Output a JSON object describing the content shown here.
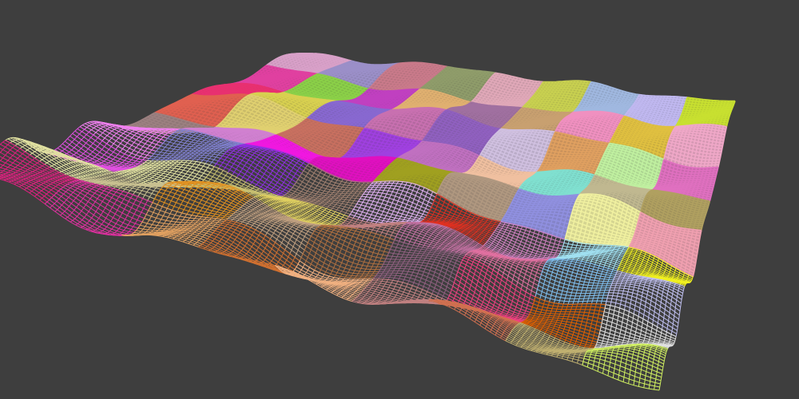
{
  "scene": {
    "background_color": "#3e3e3e",
    "grid_tiles": 9,
    "subdivisions_per_tile": 15,
    "tile_colors": [
      [
        "#d8a0c8",
        "#9b8fc8",
        "#c97a8a",
        "#8f9c6a",
        "#e0a8b8",
        "#c8d050",
        "#a0b8e0",
        "#c0b8f0",
        "#c8e030"
      ],
      [
        "#e040a0",
        "#8bd048",
        "#c040c0",
        "#e0b070",
        "#a070a0",
        "#c8a070",
        "#f090c0",
        "#e0c040",
        "#f0a8c8"
      ],
      [
        "#e83070",
        "#d8d050",
        "#8868d0",
        "#c870b0",
        "#9060c0",
        "#d0c0e0",
        "#e0a060",
        "#c0f0a0",
        "#e070c0"
      ],
      [
        "#e06050",
        "#e0d070",
        "#c87060",
        "#a040e0",
        "#c070c0",
        "#f0c0a0",
        "#80e0d0",
        "#c0b890",
        "#b0a060"
      ],
      [
        "#9c8080",
        "#d080d0",
        "#f018e0",
        "#e010c0",
        "#a0a020",
        "#b09880",
        "#9090e0",
        "#f0f0a0",
        "#f0a0b0"
      ],
      [
        "#f080f0",
        "#8080d0",
        "#9030e0",
        "#a08070",
        "#e0b0f0",
        "#e03020",
        "#d080c0",
        "#a0e0f0",
        "#f0f020"
      ],
      [
        "#e050e0",
        "#e0e0a0",
        "#c8c070",
        "#e0d060",
        "#c08080",
        "#c070a0",
        "#e070a0",
        "#80c0f0",
        "#c0c0f0"
      ],
      [
        "#e0e0a0",
        "#c8c090",
        "#e09020",
        "#c0a080",
        "#b07040",
        "#906080",
        "#f04080",
        "#e06000",
        "#e0e0e0"
      ],
      [
        "#e02080",
        "#e030a0",
        "#e0a060",
        "#d07030",
        "#f0b080",
        "#c08080",
        "#d07050",
        "#c0b070",
        "#d0f060"
      ]
    ]
  }
}
